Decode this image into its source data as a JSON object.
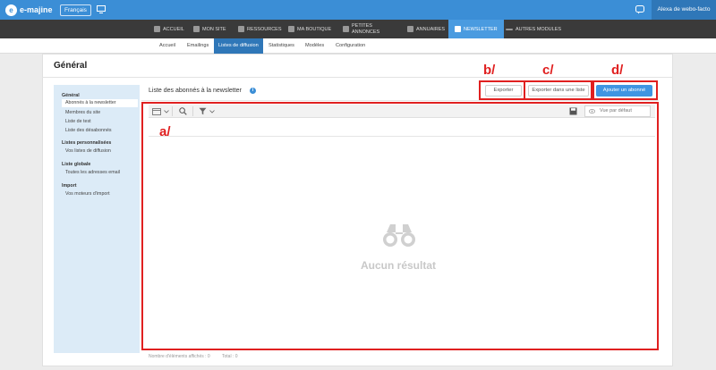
{
  "topbar": {
    "logo_text": "e-majine",
    "language_button": "Français",
    "user_name": "Alexa de webo-facto"
  },
  "main_nav": [
    {
      "label": "ACCUEIL",
      "icon": "home-icon"
    },
    {
      "label": "MON SITE",
      "icon": "monitor-icon"
    },
    {
      "label": "RESSOURCES",
      "icon": "ressources-icon"
    },
    {
      "label": "MA BOUTIQUE",
      "icon": "basket-icon"
    },
    {
      "label_line1": "PETITES",
      "label_line2": "ANNONCES",
      "icon": "grid-icon"
    },
    {
      "label": "ANNUAIRES",
      "icon": "annuaire-icon"
    },
    {
      "label": "NEWSLETTER",
      "icon": "cloud-icon",
      "active": true
    },
    {
      "label": "AUTRES MODULES",
      "icon": "dots-icon"
    }
  ],
  "sub_nav": [
    "Accueil",
    "Emailings",
    "Listes de diffusion",
    "Statistiques",
    "Modèles",
    "Configuration"
  ],
  "page_title": "Général",
  "sidebar": {
    "sections": [
      {
        "title": "Général",
        "items": [
          "Abonnés à la newsletter",
          "Membres du site",
          "Liste de test",
          "Liste des désabonnés"
        ]
      },
      {
        "title": "Listes personnalisées",
        "items": [
          "Vos listes de diffusion"
        ]
      },
      {
        "title": "Liste globale",
        "items": [
          "Toutes les adresses email"
        ]
      },
      {
        "title": "Import",
        "items": [
          "Vos moteurs d'import"
        ]
      }
    ]
  },
  "content": {
    "title": "Liste des abonnés à la newsletter",
    "info_glyph": "i",
    "buttons": {
      "export": "Exporter",
      "export_list": "Exporter dans une liste",
      "add_subscriber": "Ajouter un abonné"
    },
    "view_select": "Vue par défaut",
    "empty_message": "Aucun résultat",
    "footer_displayed": "Nombre d'éléments affichés : 0",
    "footer_total": "Total : 0"
  },
  "annotations": {
    "a": "a/",
    "b": "b/",
    "c": "c/",
    "d": "d/"
  },
  "colors": {
    "topbar": "#3b8ed6",
    "nav": "#3a3a3a",
    "active_subnav": "#2f77b8",
    "annotation": "#e02020",
    "primary_button": "#3f95e2"
  }
}
